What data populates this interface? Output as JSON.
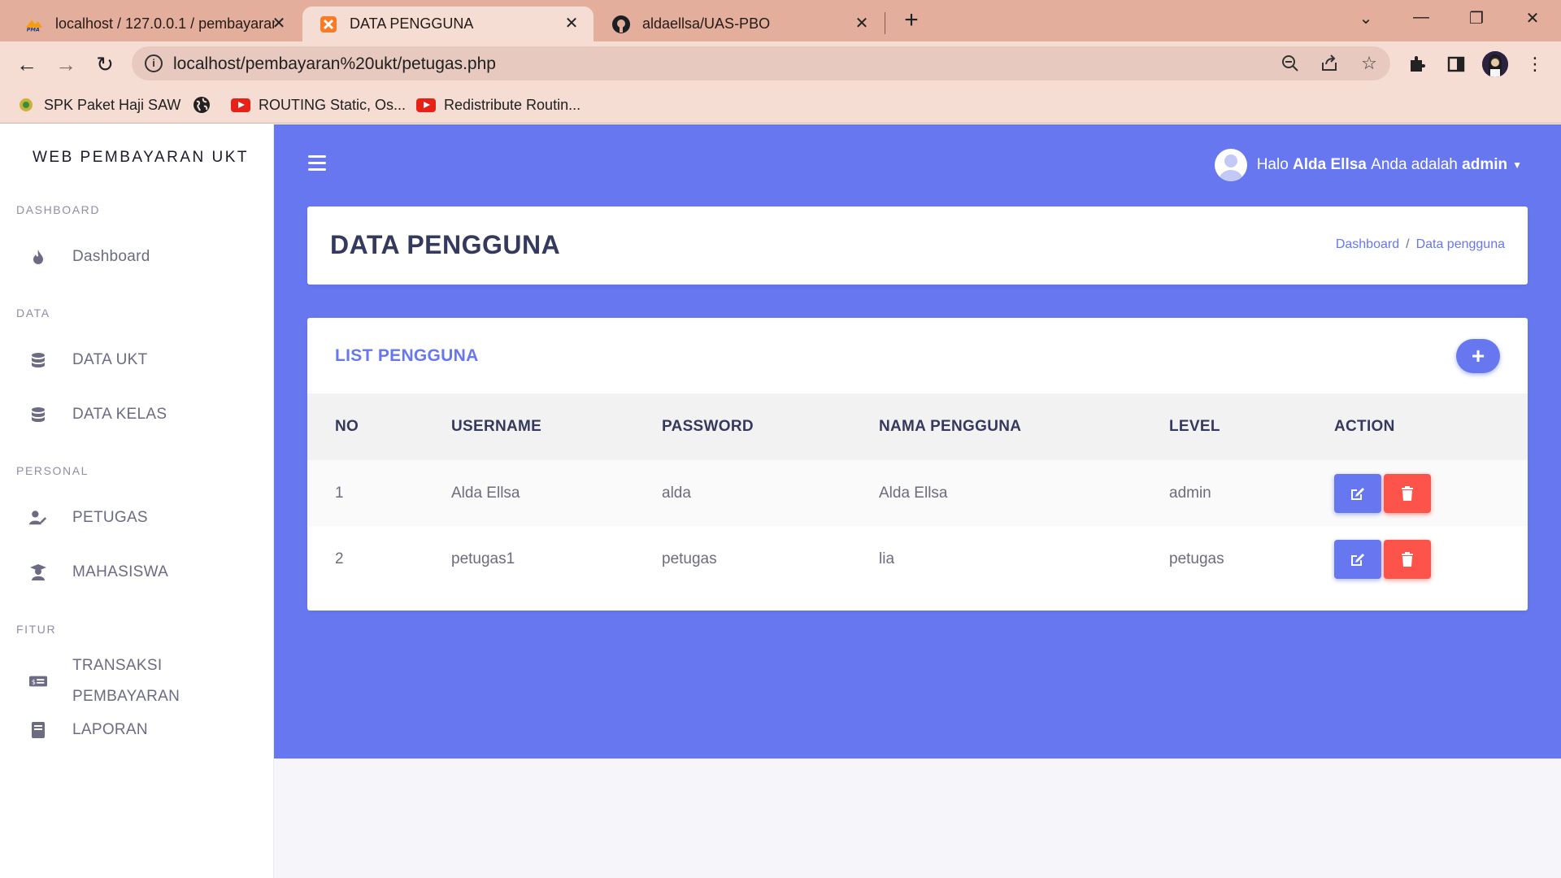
{
  "browser": {
    "tabs": [
      {
        "title": "localhost / 127.0.0.1 / pembayaran",
        "favicon": "phpmyadmin-icon"
      },
      {
        "title": "DATA PENGGUNA",
        "favicon": "xampp-icon",
        "active": true
      },
      {
        "title": "aldaellsa/UAS-PBO",
        "favicon": "github-icon"
      }
    ],
    "url": "localhost/pembayaran%20ukt/petugas.php",
    "bookmarks": [
      {
        "label": "SPK Paket Haji SAW",
        "icon": "kemenag-icon"
      },
      {
        "label": "",
        "icon": "globe-icon"
      },
      {
        "label": "ROUTING Static, Os...",
        "icon": "youtube-icon"
      },
      {
        "label": "Redistribute Routin...",
        "icon": "youtube-icon"
      }
    ],
    "chrome_color": "#e4ae9d"
  },
  "sidebar": {
    "brand": "WEB PEMBAYARAN UKT",
    "sections": [
      {
        "heading": "DASHBOARD",
        "items": [
          {
            "label": "Dashboard",
            "icon": "fire-icon"
          }
        ]
      },
      {
        "heading": "DATA",
        "items": [
          {
            "label": "DATA UKT",
            "icon": "database-icon"
          },
          {
            "label": "DATA KELAS",
            "icon": "database-icon"
          }
        ]
      },
      {
        "heading": "PERSONAL",
        "items": [
          {
            "label": "PETUGAS",
            "icon": "user-edit-icon"
          },
          {
            "label": "MAHASISWA",
            "icon": "user-graduate-icon"
          }
        ]
      },
      {
        "heading": "FITUR",
        "items": [
          {
            "label": "TRANSAKSI PEMBAYARAN",
            "icon": "money-check-icon"
          },
          {
            "label": "LAPORAN",
            "icon": "book-icon"
          }
        ]
      }
    ]
  },
  "topbar": {
    "greeting_prefix": "Halo",
    "user_name": "Alda Ellsa",
    "role_text": "Anda adalah",
    "role": "admin",
    "accent": "#6777ef"
  },
  "header": {
    "title": "DATA PENGGUNA",
    "breadcrumb": [
      "Dashboard",
      "Data pengguna"
    ]
  },
  "list": {
    "title": "LIST PENGGUNA",
    "columns": [
      "NO",
      "USERNAME",
      "PASSWORD",
      "NAMA PENGGUNA",
      "LEVEL",
      "ACTION"
    ],
    "rows": [
      {
        "no": "1",
        "username": "Alda Ellsa",
        "password": "alda",
        "nama": "Alda Ellsa",
        "level": "admin"
      },
      {
        "no": "2",
        "username": "petugas1",
        "password": "petugas",
        "nama": "lia",
        "level": "petugas"
      }
    ],
    "edit_color": "#6777ef",
    "delete_color": "#fc544b"
  }
}
